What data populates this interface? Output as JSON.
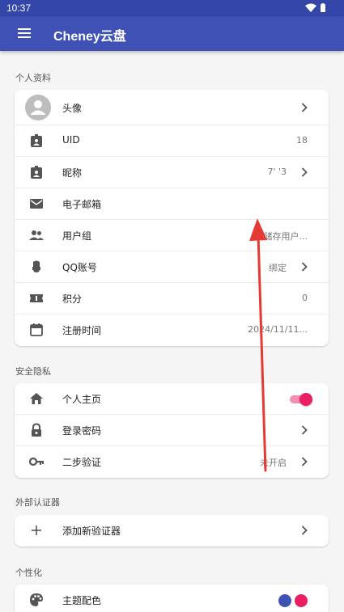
{
  "status_bar": {
    "time": "10:37"
  },
  "app_bar": {
    "title": "Cheney云盘",
    "menu_icon": "menu-icon"
  },
  "sections": {
    "profile": {
      "title": "个人资料",
      "rows": [
        {
          "label": "头像",
          "icon": "avatar-placeholder",
          "value": ""
        },
        {
          "label": "UID",
          "icon": "badge-icon",
          "value": "18"
        },
        {
          "label": "昵称",
          "icon": "badge-icon",
          "value": "7' '3"
        },
        {
          "label": "电子邮箱",
          "icon": "mail-icon",
          "value": ""
        },
        {
          "label": "用户组",
          "icon": "group-icon",
          "value": "Oi 储存用户..."
        },
        {
          "label": "QQ账号",
          "icon": "qq-icon",
          "value": "绑定"
        },
        {
          "label": "积分",
          "icon": "ticket-icon",
          "value": "0"
        },
        {
          "label": "注册时间",
          "icon": "calendar-icon",
          "value": "2024/11/11..."
        }
      ]
    },
    "security": {
      "title": "安全隐私",
      "rows": [
        {
          "label": "个人主页",
          "icon": "home-icon",
          "toggle_on": true
        },
        {
          "label": "登录密码",
          "icon": "lock-icon",
          "value": ""
        },
        {
          "label": "二步验证",
          "icon": "key-icon",
          "value": "未开启"
        }
      ]
    },
    "authenticator": {
      "title": "外部认证器",
      "rows": [
        {
          "label": "添加新验证器",
          "icon": "plus-icon"
        }
      ]
    },
    "personalize": {
      "title": "个性化",
      "rows": [
        {
          "label": "主题配色",
          "icon": "palette-icon",
          "colors": [
            "#3f51b5",
            "#e91e63"
          ]
        }
      ]
    }
  },
  "colors": {
    "primary": "#3f51b5",
    "status_bar": "#3446a8",
    "accent": "#e91e63",
    "annotation_arrow": "#e53935"
  }
}
